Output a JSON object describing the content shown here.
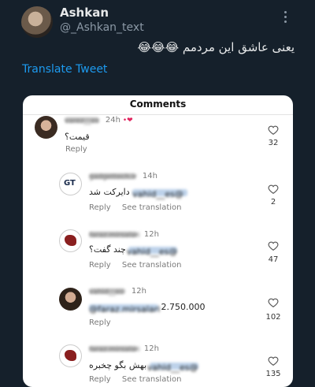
{
  "tweet": {
    "name": "Ashkan",
    "handle": "@_Ashkan_text",
    "text": "یعنی عاشق این مردمم 😂😂😂",
    "translate": "Translate Tweet"
  },
  "card": {
    "title": "Comments",
    "comments": [
      {
        "user": "varez__es",
        "time": "24h",
        "body": "قیمت؟",
        "actions": [
          "Reply"
        ],
        "likes": "32"
      },
      {
        "user": "gadgettech.ir",
        "time": "14h",
        "mention": "@vahid__es",
        "body": "دایرکت شد",
        "actions": [
          "Reply",
          "See translation"
        ],
        "likes": "2"
      },
      {
        "user": "faraz.mirsalari",
        "time": "12h",
        "mention": "@vahid__es",
        "body": "چند گفت؟",
        "actions": [
          "Reply",
          "See translation"
        ],
        "likes": "47"
      },
      {
        "user": "vahid__es",
        "time": "12h",
        "mention": "@faraz.mirsalari",
        "body": "2.750.000",
        "actions": [
          "Reply"
        ],
        "likes": "102"
      },
      {
        "user": "faraz.mirsalari",
        "time": "12h",
        "mention": "@vahid__es",
        "body": "بهش بگو چخبره",
        "actions": [
          "Reply",
          "See translation"
        ],
        "likes": "135"
      }
    ]
  },
  "colors": {
    "background": "#15202b",
    "accent": "#1d9bf0",
    "heart": "#e0245e"
  },
  "icons": [
    "more-icon",
    "heart-outline-icon",
    "heart-filled-icon"
  ]
}
